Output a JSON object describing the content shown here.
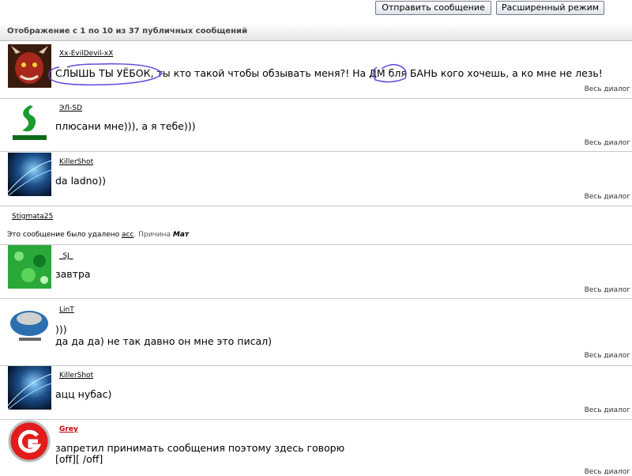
{
  "toolbar": {
    "send_label": "Отправить сообщение",
    "advanced_label": "Расширенный режим"
  },
  "info": {
    "text": "Отображение с 1 по 10 из 37 публичных сообщений"
  },
  "dialog_label": "Весь диалог",
  "posts": [
    {
      "author": "Xx-EvilDevil-xX",
      "message": "СЛЫШЬ ТЫ УЁБОК, ты кто такой чтобы обзывать меня?! На ДМ бля БАНЬ кого хочешь, а ко мне не лезь!"
    },
    {
      "author": "ЭЛ-SD",
      "message": "плюсани мне))), а я тебе)))"
    },
    {
      "author": "KillerShot",
      "message": "da ladno))"
    },
    {
      "author": "_SJ_",
      "message": "завтра"
    },
    {
      "author": "LinT",
      "message_line1": ")))",
      "message_line2": "да да да) не так давно он мне это писал)"
    },
    {
      "author": "KillerShot",
      "message": "ацц нубас)"
    },
    {
      "author": "Grey",
      "message_line1": "запретил принимать сообщения поэтому здесь говорю",
      "message_line2": "[off][ /off]"
    }
  ],
  "deleted": {
    "author": "Stigmata25",
    "prefix": "Это сообщение было удалено",
    "moderator": "acc",
    "reason_label": ". Причина",
    "reason_value": "Мат"
  }
}
